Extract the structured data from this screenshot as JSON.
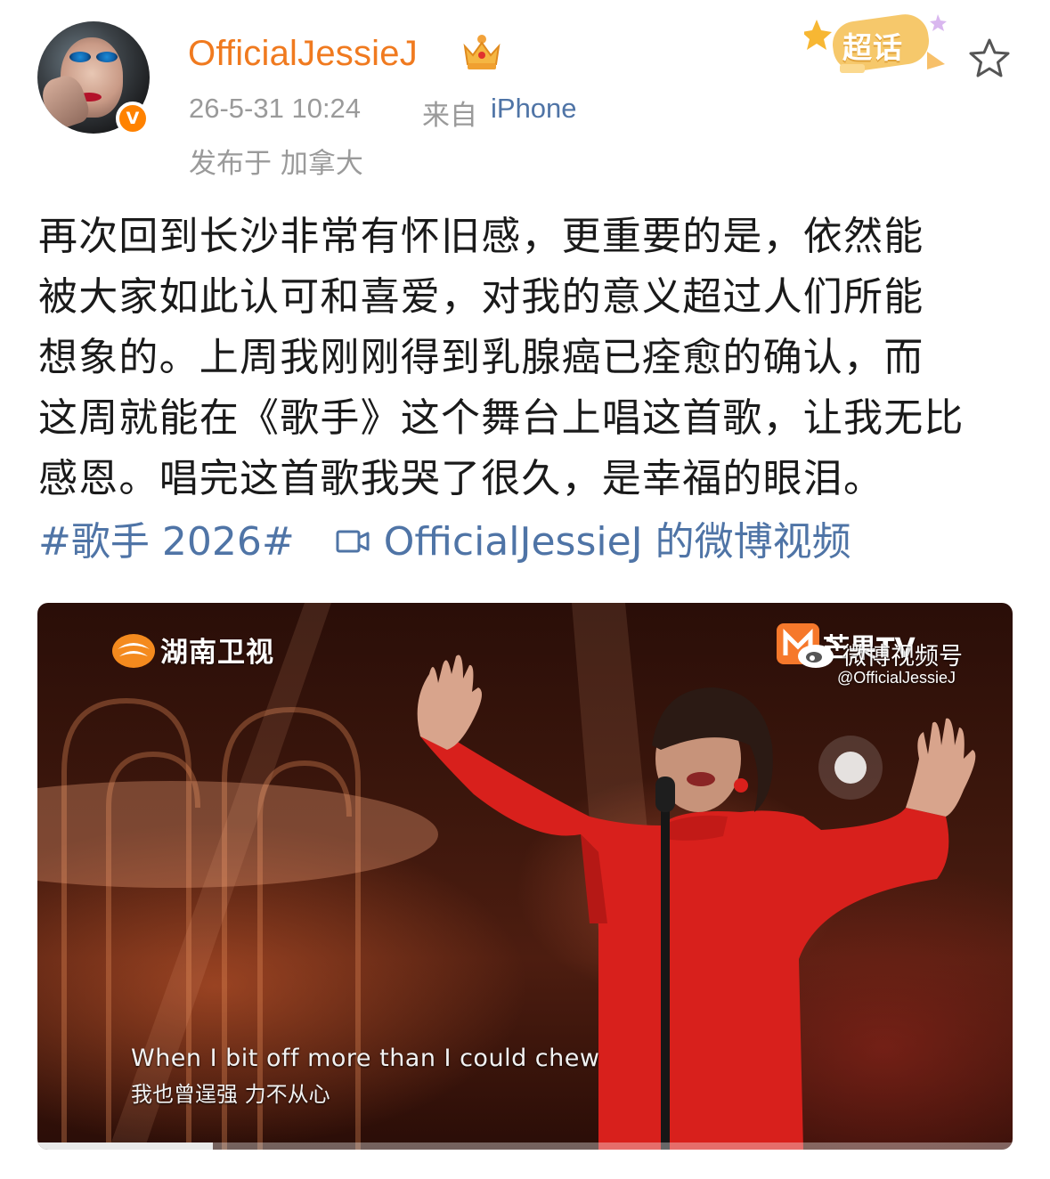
{
  "post": {
    "author": "OfficialJessieJ",
    "timestamp": "26-5-31 10:24",
    "source_prefix": "来自",
    "device": "iPhone",
    "location": "发布于 加拿大",
    "supertopic_badge": "超话",
    "text_lines": [
      "再次回到长沙非常有怀旧感，更重要的是，依然能",
      "被大家如此认可和喜爱，对我的意义超过人们所能",
      "想象的。上周我刚刚得到乳腺癌已痊愈的确认，而",
      "这周就能在《歌手》这个舞台上唱这首歌，让我无比",
      "感恩。唱完这首歌我哭了很久，是幸福的眼泪。"
    ],
    "hashtag": "#歌手 2026#",
    "video_link": "OfficialJessieJ 的微博视频"
  },
  "video": {
    "channel_logo_text": "湖南卫视",
    "mango_text": "芒果TV",
    "weibo_channel": "微博视频号",
    "weibo_handle": "@OfficialJessieJ",
    "subtitle_en": "When I bit off more than I could chew",
    "subtitle_zh": "我也曾逞强  力不从心",
    "progress": 0.18
  },
  "colors": {
    "username": "#f07a1f",
    "link": "#4f74a6",
    "meta": "#9a9a9a",
    "verified_badge": "#ff8200",
    "dress": "#d8201c"
  },
  "icons": [
    "verified-badge-icon",
    "crown-icon",
    "supertopic-icon",
    "star-icon",
    "video-icon",
    "weibo-icon"
  ]
}
